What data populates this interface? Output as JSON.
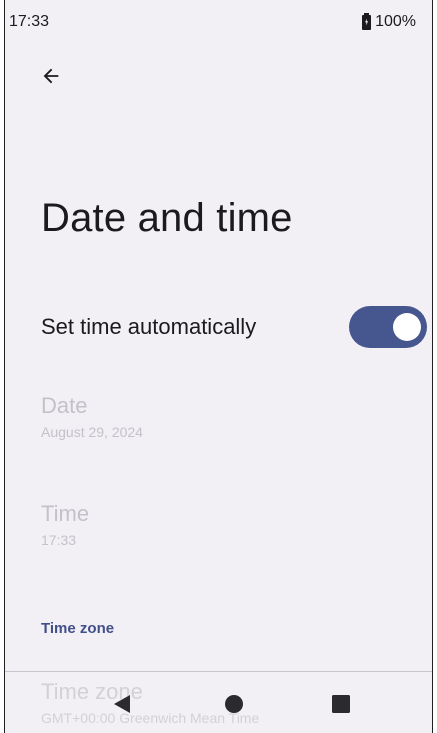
{
  "status_bar": {
    "time": "17:33",
    "battery_percent": "100%",
    "battery_icon": "battery-charging-icon"
  },
  "header": {
    "back_icon": "arrow-left-icon",
    "title": "Date and time"
  },
  "settings": {
    "auto_time": {
      "label": "Set time automatically",
      "enabled": true
    },
    "date": {
      "title": "Date",
      "value": "August 29, 2024"
    },
    "time": {
      "title": "Time",
      "value": "17:33"
    },
    "timezone_section": {
      "header": "Time zone"
    },
    "timezone": {
      "title": "Time zone",
      "value": "GMT+00:00 Greenwich Mean Time"
    }
  },
  "nav_bar": {
    "back_icon": "triangle-back-icon",
    "home_icon": "circle-home-icon",
    "recents_icon": "square-recents-icon"
  },
  "colors": {
    "background": "#f2eff5",
    "accent": "#46568f",
    "section_header": "#42508a",
    "disabled_text": "#c4c2c8"
  }
}
